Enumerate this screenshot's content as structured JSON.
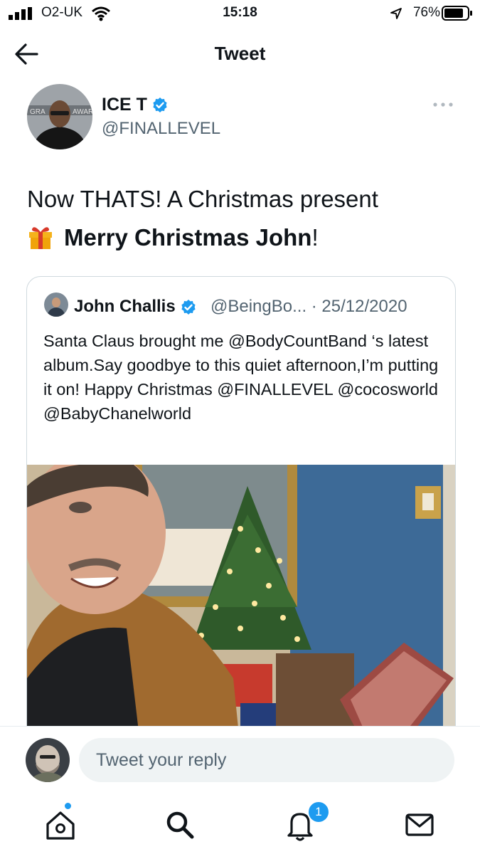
{
  "status_bar": {
    "carrier": "O2-UK",
    "time": "15:18",
    "battery": "76%"
  },
  "header": {
    "title": "Tweet"
  },
  "tweet": {
    "author_name": "ICE T",
    "author_handle": "@FINALLEVEL",
    "text_line1": "Now THATS! A Christmas present",
    "text_bold": "Merry Christmas John",
    "text_end": "!"
  },
  "quoted": {
    "author_name": "John Challis",
    "meta": "@BeingBo... · 25/12/2020",
    "text": "Santa Claus brought me @BodyCountBand  ‘s latest album.Say goodbye to this quiet afternoon,I’m putting it on! Happy Christmas @FINALLEVEL  @cocosworld @BabyChanelworld"
  },
  "reply": {
    "placeholder": "Tweet your reply"
  },
  "tabbar": {
    "notifications_badge": "1"
  },
  "colors": {
    "accent": "#1d9bf0",
    "secondary_text": "#536471"
  }
}
